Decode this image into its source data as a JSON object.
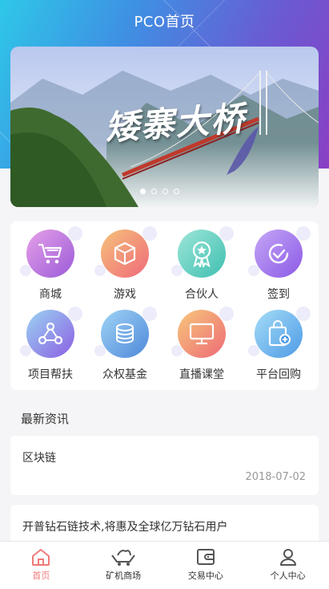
{
  "header": {
    "title": "PCO首页"
  },
  "banner": {
    "caption": "矮寨大桥",
    "slide_count": 4,
    "active_slide": 1
  },
  "menu": {
    "items": [
      {
        "label": "商城",
        "icon": "cart-icon",
        "colors": [
          "#e6a0e8",
          "#9a5bd8"
        ]
      },
      {
        "label": "游戏",
        "icon": "box-icon",
        "colors": [
          "#f6c27a",
          "#ef6a7a"
        ]
      },
      {
        "label": "合伙人",
        "icon": "award-icon",
        "colors": [
          "#9de6d8",
          "#3fbfb1"
        ]
      },
      {
        "label": "签到",
        "icon": "checkin-icon",
        "colors": [
          "#c5a6f6",
          "#8b5ae6"
        ]
      },
      {
        "label": "项目帮扶",
        "icon": "network-icon",
        "colors": [
          "#9ad3f2",
          "#8c5fe3"
        ]
      },
      {
        "label": "众权基金",
        "icon": "coins-icon",
        "colors": [
          "#9fd4f5",
          "#4f88da"
        ]
      },
      {
        "label": "直播课堂",
        "icon": "screen-icon",
        "colors": [
          "#f7c67a",
          "#ee6b77"
        ]
      },
      {
        "label": "平台回购",
        "icon": "bag-icon",
        "colors": [
          "#a5dcf7",
          "#4d9be6"
        ]
      }
    ]
  },
  "news": {
    "section_title": "最新资讯",
    "items": [
      {
        "title": "区块链",
        "date": "2018-07-02"
      },
      {
        "title": "开普钻石链技术,将惠及全球亿万钻石用户",
        "date": ""
      }
    ]
  },
  "tabbar": {
    "items": [
      {
        "label": "首页",
        "icon": "home-icon",
        "active": true
      },
      {
        "label": "矿机商场",
        "icon": "mining-cart-icon",
        "active": false
      },
      {
        "label": "交易中心",
        "icon": "wallet-icon",
        "active": false
      },
      {
        "label": "个人中心",
        "icon": "user-icon",
        "active": false
      }
    ]
  },
  "colors": {
    "accent": "#f07a7a",
    "header_start": "#2ec8e8",
    "header_end": "#8a3fc4"
  }
}
